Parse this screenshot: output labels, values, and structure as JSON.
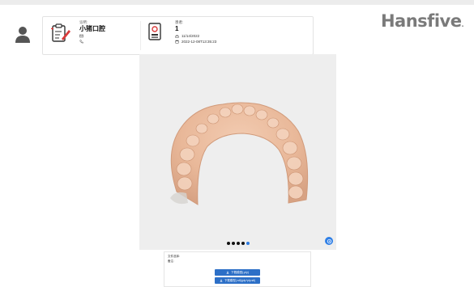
{
  "brand": {
    "logo_text": "Hansfive",
    "logo_suffix": "."
  },
  "clinic": {
    "label": "诊所:",
    "name": "小猪口腔",
    "email": "",
    "phone": ""
  },
  "patient": {
    "label": "患者:",
    "id": "1",
    "birth_date": "11/14/2022",
    "scan_datetime": "2022-12-08T13:35:23"
  },
  "viewer": {
    "page_dots": 5,
    "active_dot_index": 4
  },
  "download": {
    "label_a": "文件选择:",
    "label_b": "备注:",
    "button_1": "下载模型(.ply)",
    "button_2": "下载模型(.stl)(ply+ply.stl)"
  },
  "colors": {
    "accent": "#2f7fe6",
    "button": "#2c6fc7",
    "model": "#e9b899"
  }
}
